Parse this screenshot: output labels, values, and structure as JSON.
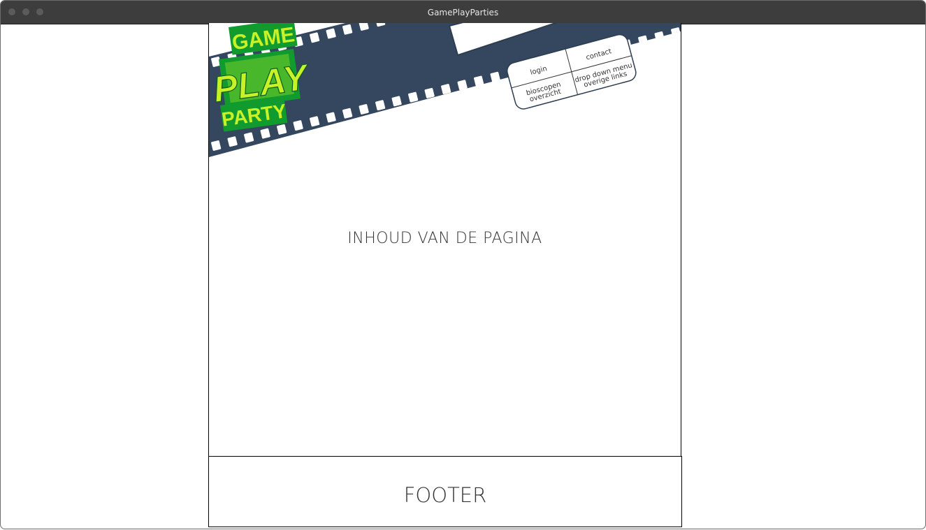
{
  "window": {
    "title": "GamePlayParties"
  },
  "logo": {
    "line1": "GAME",
    "line2": "PLAY",
    "line3": "PARTY"
  },
  "nav": {
    "login": "login",
    "contact": "contact",
    "bioscopen_line1": "bioscopen",
    "bioscopen_line2": "overzicht",
    "dropdown_line1": "drop down menu",
    "dropdown_line2": "overige links"
  },
  "main": {
    "content_text": "INHOUD VAN DE PAGINA"
  },
  "footer": {
    "text": "FOOTER"
  },
  "colors": {
    "film_strip": "#34475f",
    "logo_green": "#119a2d",
    "logo_yellow": "#c8f227",
    "titlebar": "#3d3d3d"
  }
}
